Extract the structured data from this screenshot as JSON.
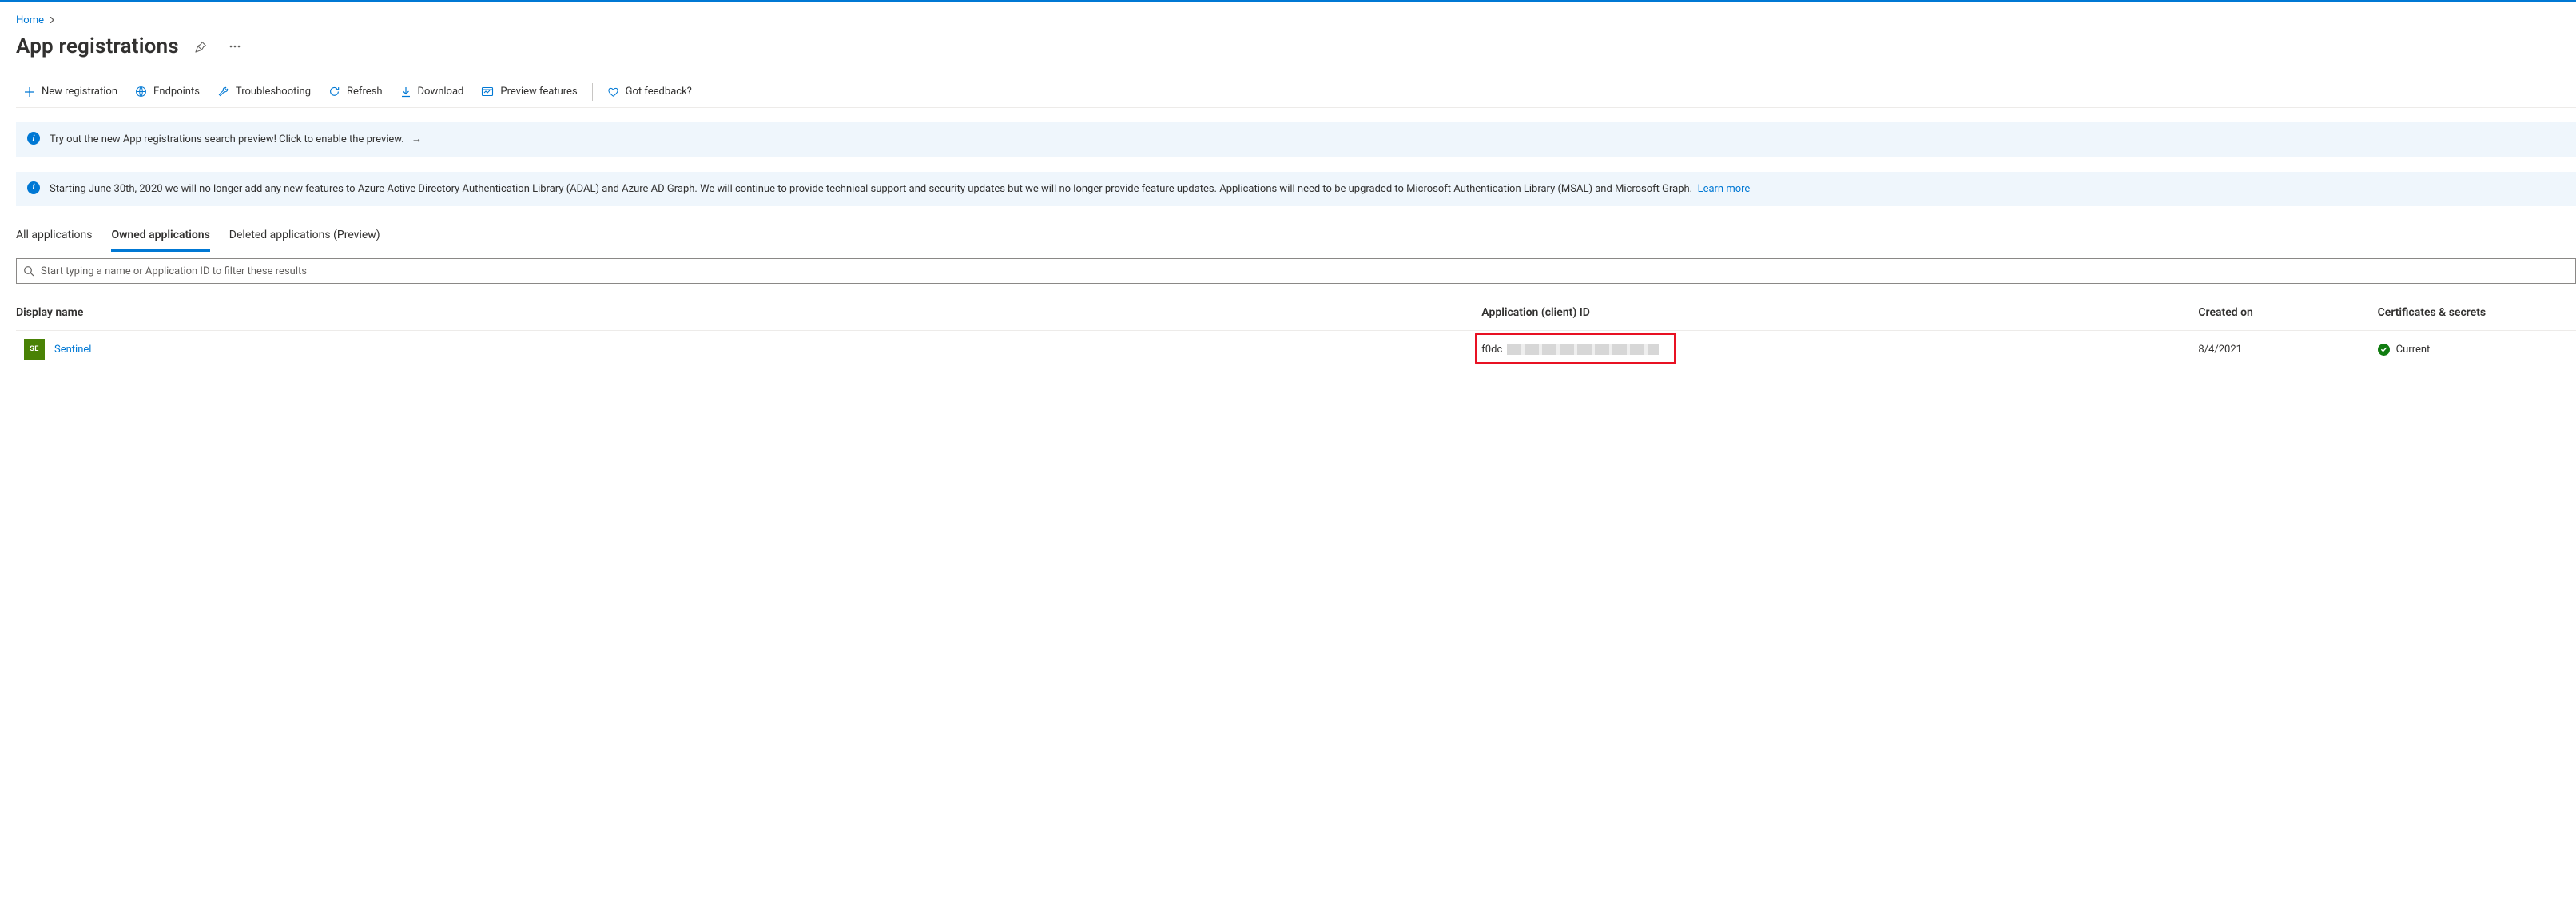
{
  "breadcrumb": {
    "home": "Home"
  },
  "page": {
    "title": "App registrations"
  },
  "toolbar": {
    "new_registration": "New registration",
    "endpoints": "Endpoints",
    "troubleshooting": "Troubleshooting",
    "refresh": "Refresh",
    "download": "Download",
    "preview_features": "Preview features",
    "feedback": "Got feedback?"
  },
  "banners": {
    "preview": "Try out the new App registrations search preview! Click to enable the preview.",
    "deprecation": "Starting June 30th, 2020 we will no longer add any new features to Azure Active Directory Authentication Library (ADAL) and Azure AD Graph. We will continue to provide technical support and security updates but we will no longer provide feature updates. Applications will need to be upgraded to Microsoft Authentication Library (MSAL) and Microsoft Graph.",
    "deprecation_link": "Learn more"
  },
  "tabs": {
    "all": "All applications",
    "owned": "Owned applications",
    "deleted": "Deleted applications (Preview)"
  },
  "search": {
    "placeholder": "Start typing a name or Application ID to filter these results"
  },
  "table": {
    "headers": {
      "display_name": "Display name",
      "client_id": "Application (client) ID",
      "created_on": "Created on",
      "certs": "Certificates & secrets"
    },
    "rows": [
      {
        "badge": "SE",
        "name": "Sentinel",
        "client_id_prefix": "f0dc",
        "created_on": "8/4/2021",
        "cert_status": "Current"
      }
    ]
  }
}
